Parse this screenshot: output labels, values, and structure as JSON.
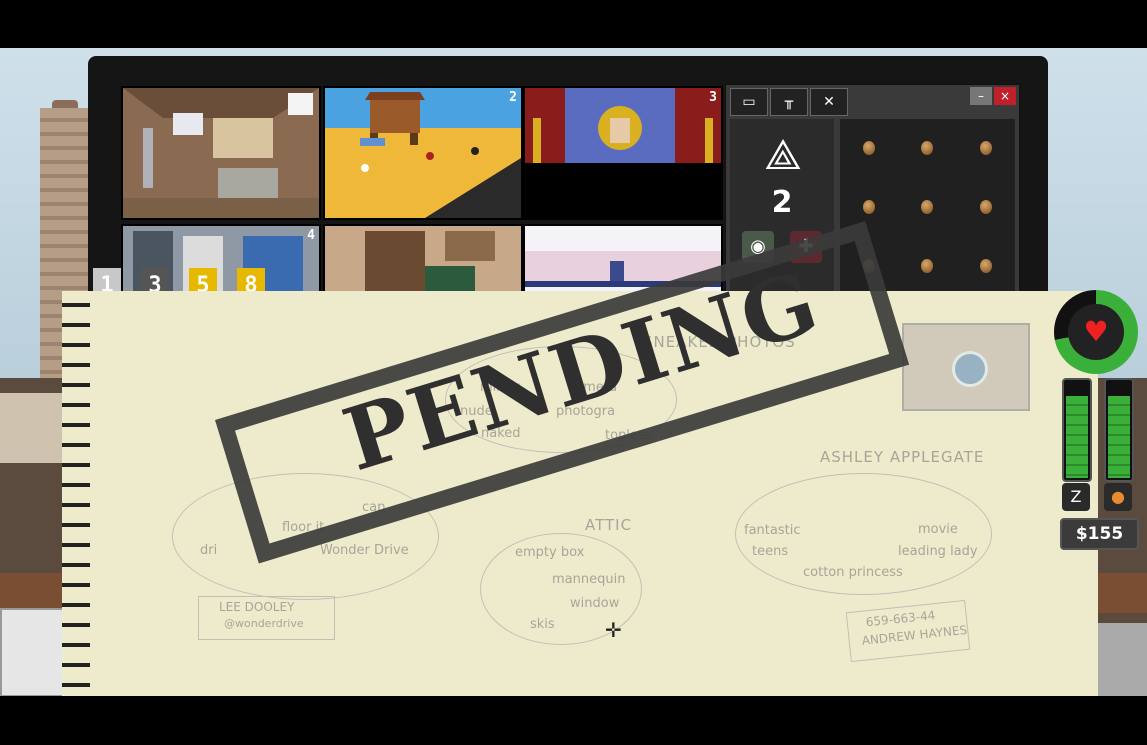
{
  "cameras": [
    {
      "id": "attic",
      "num": ""
    },
    {
      "id": "barn",
      "num": "2"
    },
    {
      "id": "theater",
      "num": "3"
    },
    {
      "id": "lab",
      "num": "4"
    },
    {
      "id": "library",
      "num": ""
    },
    {
      "id": "plane",
      "num": ""
    }
  ],
  "camera_selector": [
    "1",
    "3",
    "5",
    "8"
  ],
  "panel": {
    "badge_count": "2",
    "tabs": [
      "film-icon",
      "bench-icon",
      "close-x-icon"
    ]
  },
  "notebook": {
    "sneaked_photos": "SNEAKED PHOTOS",
    "words1": [
      "mirror",
      "camera",
      "nude",
      "photogra",
      "naked",
      "topless"
    ],
    "words2": [
      "cap",
      "floor it",
      "dri",
      "Wonder Drive"
    ],
    "attic": "ATTIC",
    "words3": [
      "empty box",
      "mannequin",
      "window",
      "skis"
    ],
    "ashley": "ASHLEY APPLEGATE",
    "words4": [
      "fantastic",
      "movie",
      "teens",
      "leading lady",
      "cotton princess"
    ],
    "lee": "LEE DOOLEY",
    "lee_sub": "@wonderdrive",
    "phone": "659-663-44",
    "andrew": "ANDREW HAYNES"
  },
  "stamp": "PENDING",
  "status": {
    "health_fill": 0.72,
    "sleep_level": 0.85,
    "hunger_level": 0.85,
    "money": "$155"
  },
  "colors": {
    "green": "#3ab03a",
    "stamp": "#2f2f2f",
    "paper": "#eeebcd",
    "red": "#e22"
  }
}
